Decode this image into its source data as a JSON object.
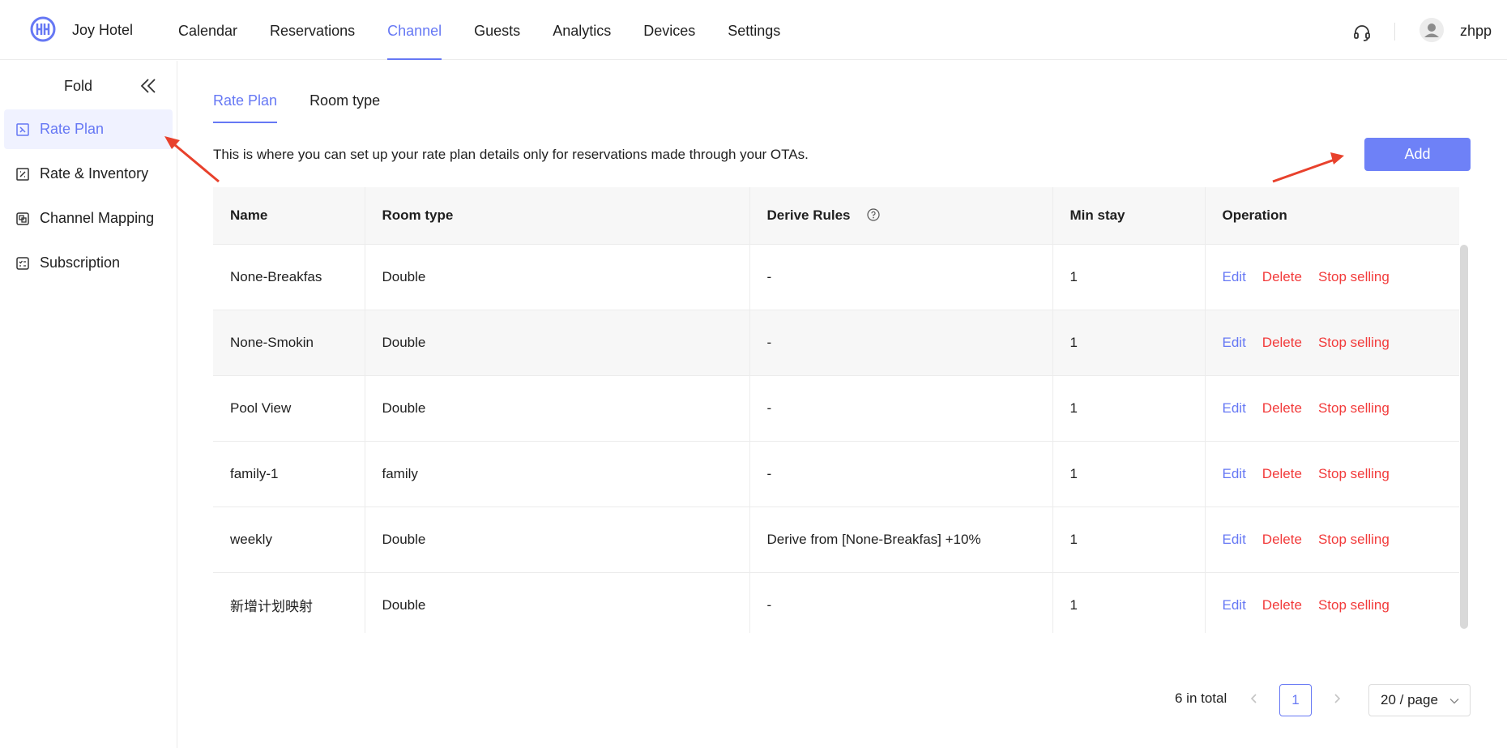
{
  "header": {
    "hotel_name": "Joy Hotel",
    "nav": [
      "Calendar",
      "Reservations",
      "Channel",
      "Guests",
      "Analytics",
      "Devices",
      "Settings"
    ],
    "active_nav": "Channel",
    "username": "zhpp"
  },
  "sidebar": {
    "fold_label": "Fold",
    "items": [
      {
        "label": "Rate Plan",
        "icon": "rate-plan-icon"
      },
      {
        "label": "Rate & Inventory",
        "icon": "rate-inventory-icon"
      },
      {
        "label": "Channel Mapping",
        "icon": "channel-mapping-icon"
      },
      {
        "label": "Subscription",
        "icon": "subscription-icon"
      }
    ]
  },
  "main": {
    "tabs": [
      "Rate Plan",
      "Room type"
    ],
    "description": "This is where you can set up your rate plan details only for reservations made through your OTAs.",
    "add_label": "Add",
    "table": {
      "headers": [
        "Name",
        "Room type",
        "Derive Rules",
        "Min stay",
        "Operation"
      ],
      "rows": [
        {
          "name": "None-Breakfas",
          "room_type": "Double",
          "derive": "-",
          "min_stay": "1"
        },
        {
          "name": "None-Smokin",
          "room_type": "Double",
          "derive": "-",
          "min_stay": "1"
        },
        {
          "name": "Pool View",
          "room_type": "Double",
          "derive": "-",
          "min_stay": "1"
        },
        {
          "name": "family-1",
          "room_type": "family",
          "derive": "-",
          "min_stay": "1"
        },
        {
          "name": "weekly",
          "room_type": "Double",
          "derive": "Derive from [None-Breakfas] +10%",
          "min_stay": "1"
        },
        {
          "name": "新增计划映射",
          "room_type": "Double",
          "derive": "-",
          "min_stay": "1"
        }
      ],
      "ops": {
        "edit": "Edit",
        "delete": "Delete",
        "stop": "Stop selling"
      }
    },
    "pagination": {
      "total": "6 in total",
      "current": "1",
      "page_size": "20 / page"
    }
  },
  "colors": {
    "accent": "#6678f4",
    "danger": "#f23a3a",
    "annotation_arrow": "#e8412c"
  }
}
